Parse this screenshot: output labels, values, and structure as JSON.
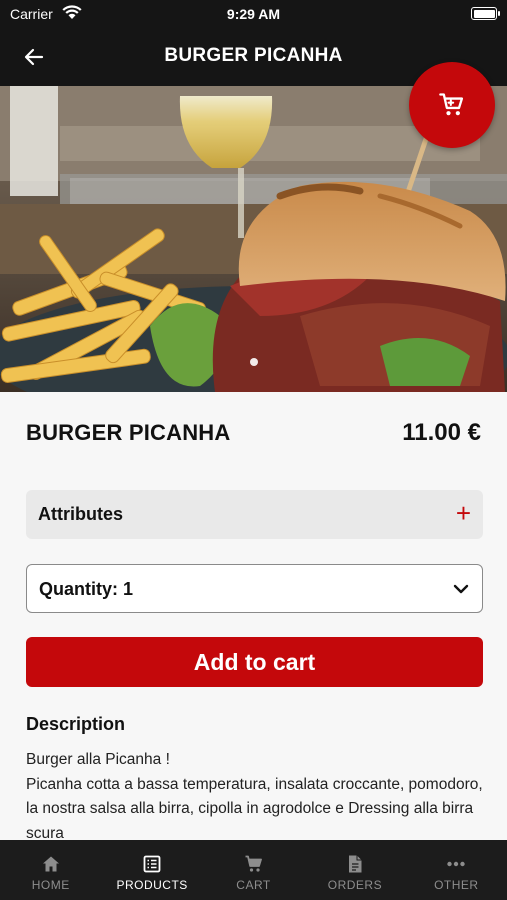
{
  "status_bar": {
    "carrier": "Carrier",
    "time": "9:29 AM"
  },
  "nav": {
    "title": "BURGER PICANHA"
  },
  "product": {
    "name": "BURGER PICANHA",
    "price": "11.00 €",
    "attributes_label": "Attributes",
    "attributes_icon": "+",
    "quantity_label": "Quantity: 1",
    "add_to_cart_label": "Add to cart",
    "description_title": "Description",
    "description": "Burger alla Picanha !\nPicanha cotta a bassa temperatura, insalata croccante, pomodoro, la nostra salsa alla birra, cipolla in agrodolce e Dressing alla birra scura"
  },
  "icons": {
    "back": "arrow-left-icon",
    "cart_fab": "shopping-cart-icon",
    "quantity_dropdown": "chevron-down-icon"
  },
  "tabs": [
    {
      "label": "HOME",
      "icon": "home-icon",
      "active": false
    },
    {
      "label": "PRODUCTS",
      "icon": "list-icon",
      "active": true
    },
    {
      "label": "CART",
      "icon": "cart-icon",
      "active": false
    },
    {
      "label": "ORDERS",
      "icon": "document-icon",
      "active": false
    },
    {
      "label": "OTHER",
      "icon": "more-icon",
      "active": false
    }
  ],
  "colors": {
    "accent": "#c4080b",
    "bar_background": "#151515",
    "tab_background": "#1c1c1c"
  }
}
